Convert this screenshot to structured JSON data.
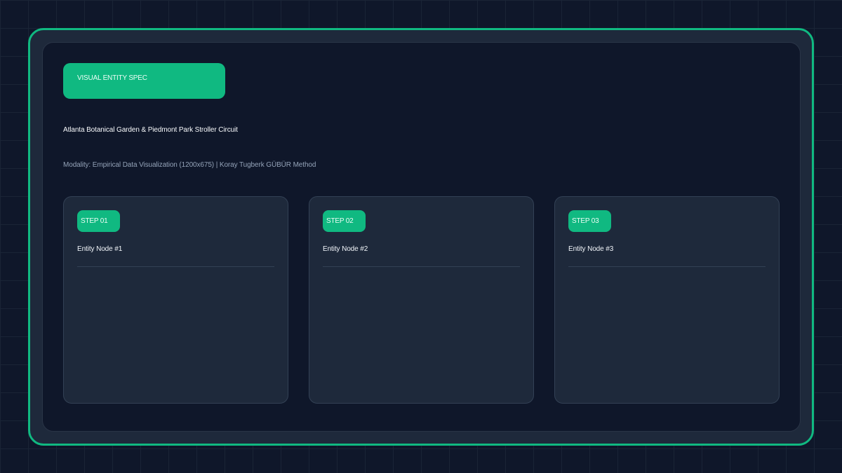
{
  "header": {
    "badge_label": "VISUAL ENTITY SPEC",
    "title": "Atlanta Botanical Garden & Piedmont Park Stroller Circuit",
    "modality": "Modality: Empirical Data Visualization (1200x675) | Koray Tugberk GÜBÜR Method"
  },
  "steps": [
    {
      "badge": "STEP 01",
      "node": "Entity Node #1"
    },
    {
      "badge": "STEP 02",
      "node": "Entity Node #2"
    },
    {
      "badge": "STEP 03",
      "node": "Entity Node #3"
    }
  ],
  "colors": {
    "accent": "#10b981",
    "background": "#0f172a",
    "card": "#1e293b",
    "border": "#334155"
  }
}
